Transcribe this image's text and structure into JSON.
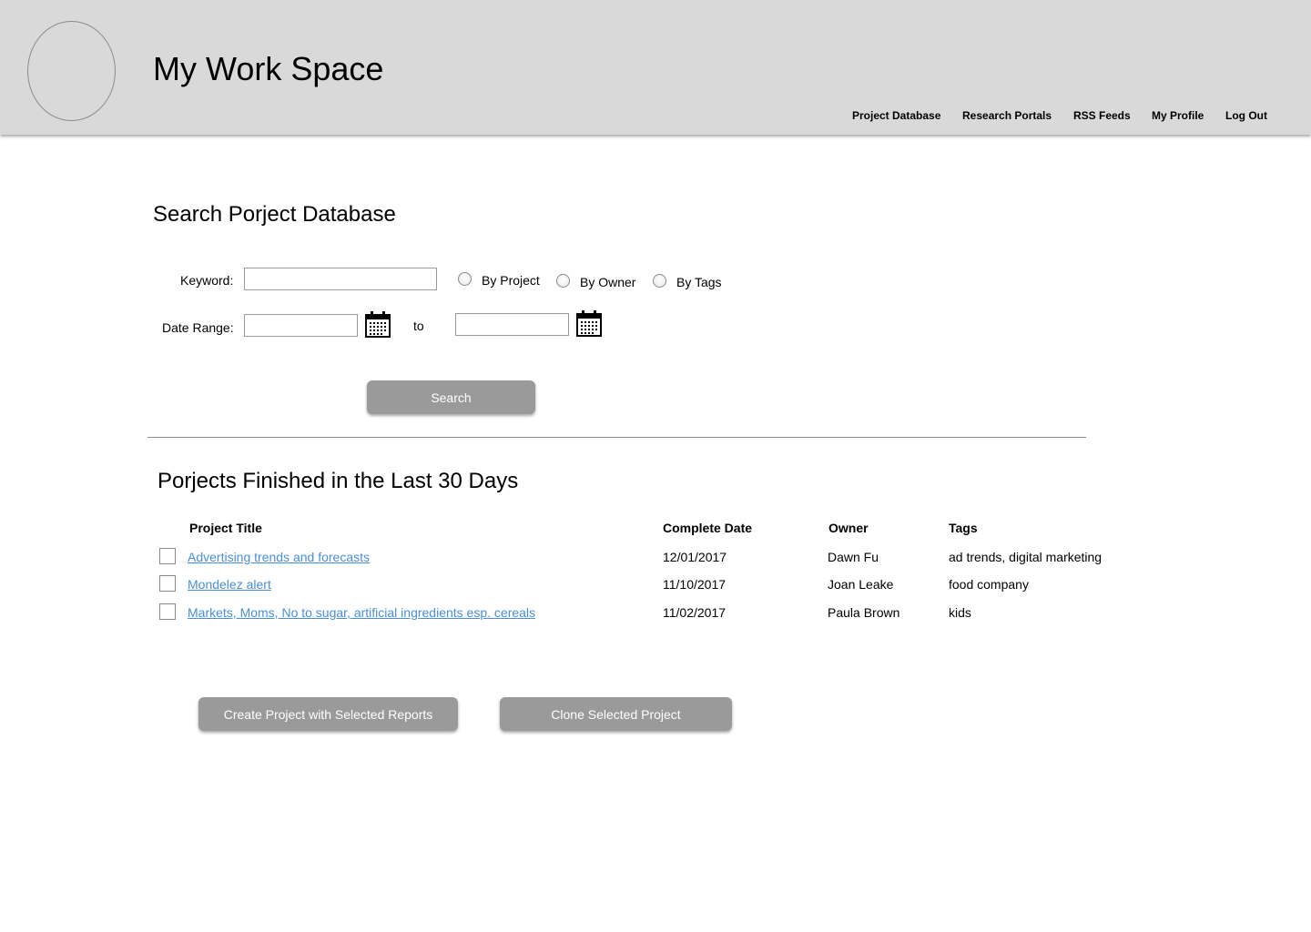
{
  "header": {
    "title": "My Work Space",
    "logo_icon": "logo-placeholder-icon",
    "nav": [
      {
        "label": "Project Database"
      },
      {
        "label": "Research Portals"
      },
      {
        "label": "RSS Feeds"
      },
      {
        "label": "My Profile"
      },
      {
        "label": "Log Out"
      }
    ]
  },
  "search": {
    "title": "Search Porject Database",
    "keyword_label": "Keyword:",
    "keyword_value": "",
    "radios": [
      {
        "label": "By Project",
        "checked": false
      },
      {
        "label": "By Owner",
        "checked": false
      },
      {
        "label": "By Tags",
        "checked": false
      }
    ],
    "date_range_label": "Date Range:",
    "date_from_value": "",
    "date_to_value": "",
    "to_label": "to",
    "calendar_icon": "calendar-icon",
    "search_button": "Search"
  },
  "results": {
    "title": "Porjects Finished in the Last 30 Days",
    "columns": {
      "title": "Project Title",
      "date": "Complete Date",
      "owner": "Owner",
      "tags": "Tags"
    },
    "rows": [
      {
        "title": "Advertising trends and forecasts",
        "date": "12/01/2017",
        "owner": "Dawn Fu",
        "tags": "ad trends, digital marketing",
        "checked": false
      },
      {
        "title": "Mondelez alert",
        "date": "11/10/2017",
        "owner": "Joan Leake",
        "tags": "food company",
        "checked": false
      },
      {
        "title": "Markets, Moms, No to sugar, artificial ingredients esp. cereals",
        "date": "11/02/2017",
        "owner": "Paula Brown",
        "tags": "kids",
        "checked": false
      }
    ],
    "create_button": "Create Project with Selected Reports",
    "clone_button": "Clone Selected Project"
  },
  "colors": {
    "header_bg": "#d9d9d9",
    "button_bg": "#9a9a9a",
    "link": "#4a8fd4"
  }
}
